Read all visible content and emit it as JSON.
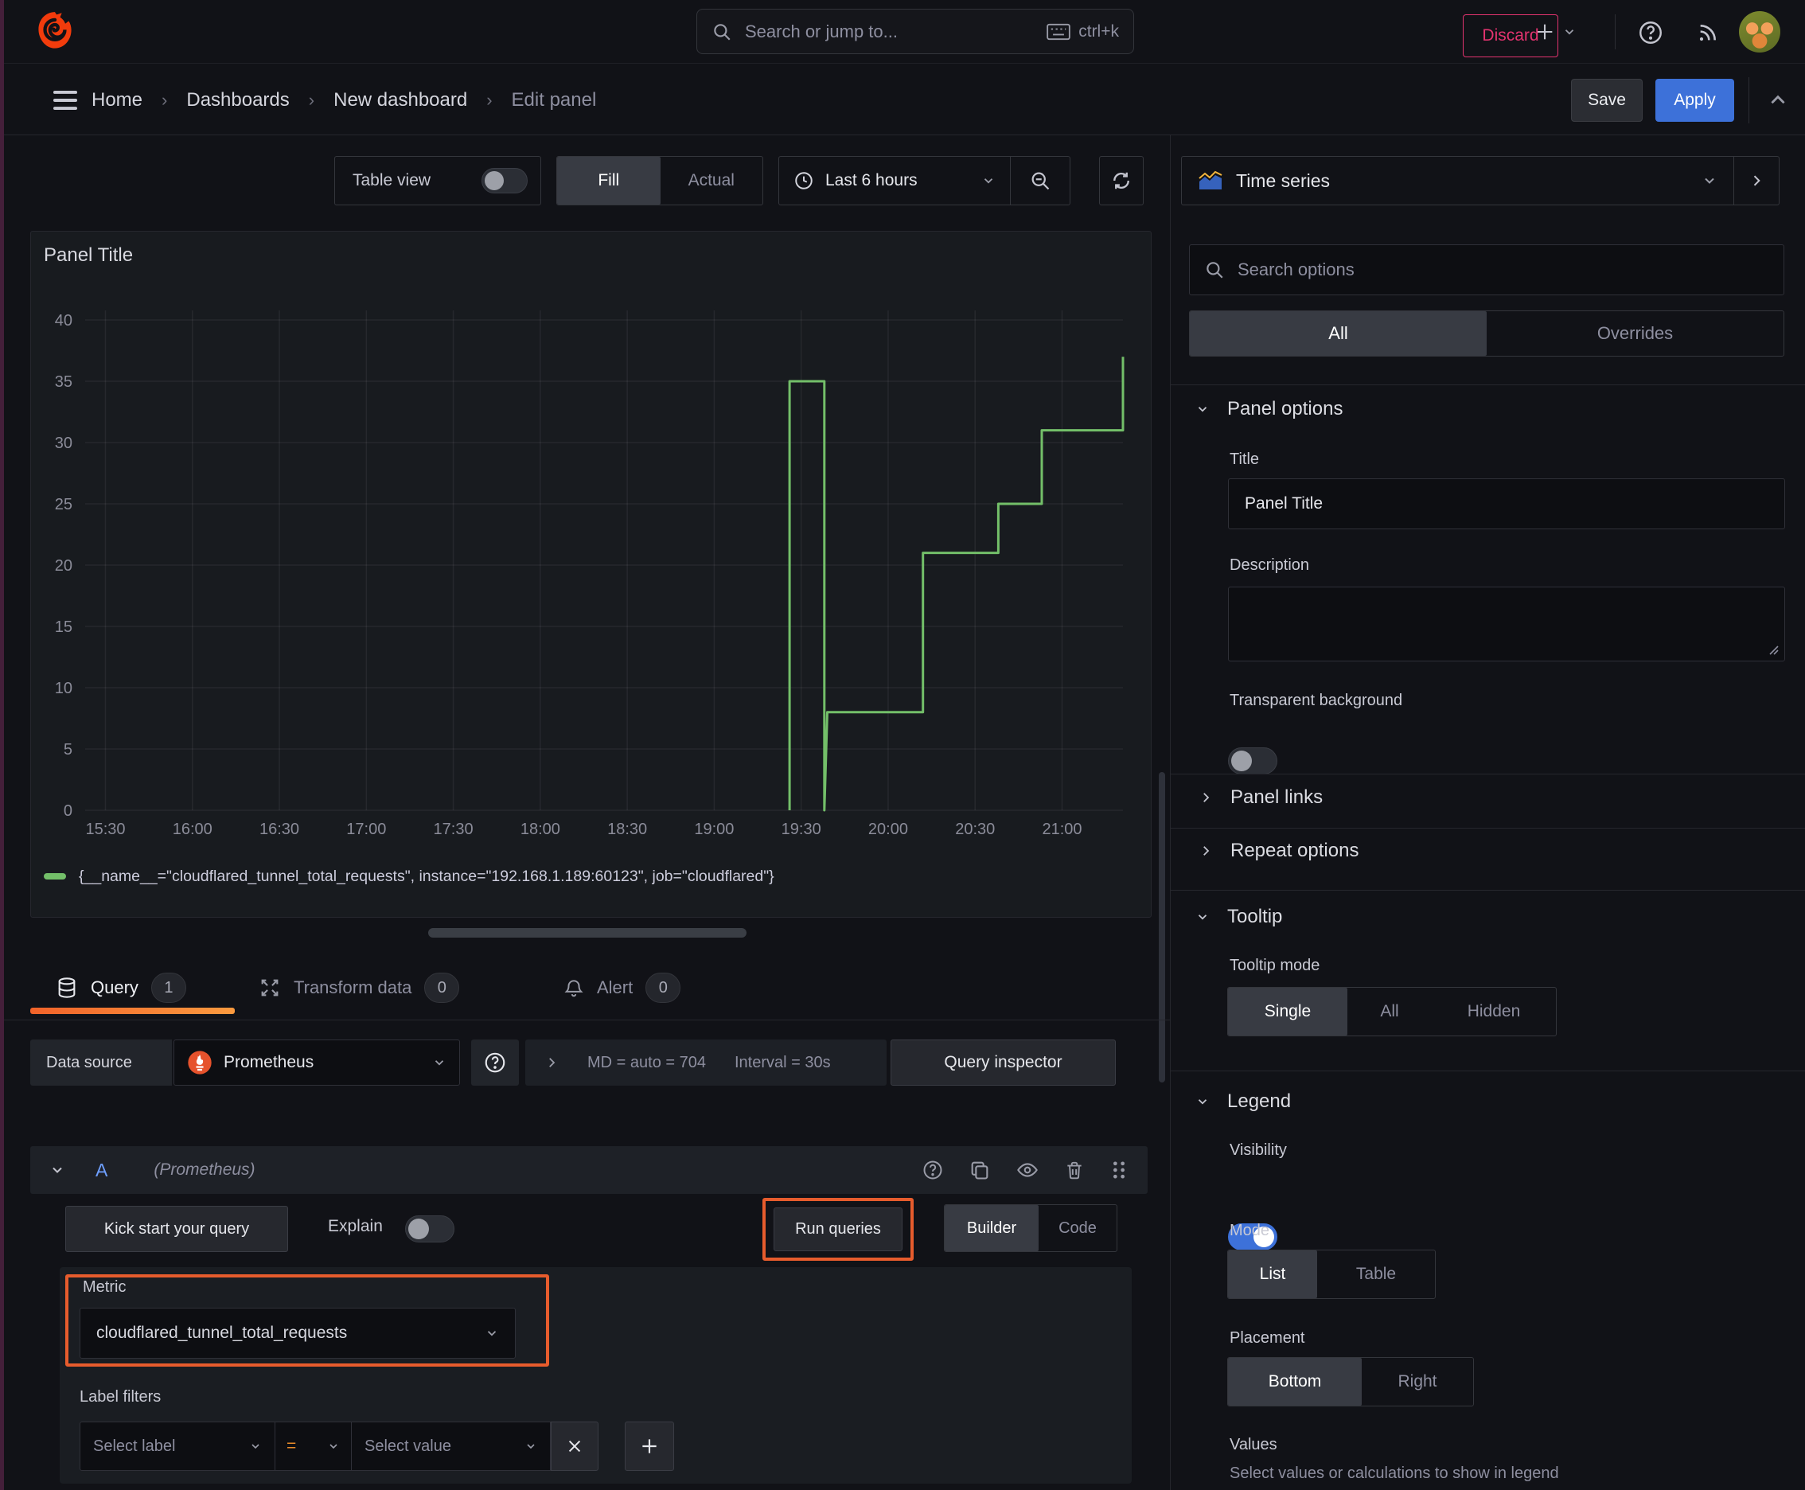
{
  "topbar": {
    "search_placeholder": "Search or jump to...",
    "shortcut": "ctrl+k"
  },
  "breadcrumb": {
    "items": [
      "Home",
      "Dashboards",
      "New dashboard",
      "Edit panel"
    ]
  },
  "actions": {
    "discard": "Discard",
    "save": "Save",
    "apply": "Apply"
  },
  "toolbar": {
    "table_view": "Table view",
    "fill": "Fill",
    "actual": "Actual",
    "time_range": "Last 6 hours"
  },
  "viz_picker": {
    "label": "Time series"
  },
  "panel": {
    "title": "Panel Title"
  },
  "chart_data": {
    "type": "line",
    "line_style": "step",
    "title": "Panel Title",
    "x_domain": [
      "15:23",
      "21:21"
    ],
    "x_ticks": [
      "15:30",
      "16:00",
      "16:30",
      "17:00",
      "17:30",
      "18:00",
      "18:30",
      "19:00",
      "19:30",
      "20:00",
      "20:30",
      "21:00"
    ],
    "ylim": [
      0,
      40
    ],
    "y_ticks": [
      0,
      5,
      10,
      15,
      20,
      25,
      30,
      35,
      40
    ],
    "grid": true,
    "legend_position": "bottom",
    "series": [
      {
        "name": "{__name__=\"cloudflared_tunnel_total_requests\", instance=\"192.168.1.189:60123\", job=\"cloudflared\"}",
        "color": "#73bf69",
        "points": [
          [
            "19:26",
            0
          ],
          [
            "19:26",
            35
          ],
          [
            "19:38",
            35
          ],
          [
            "19:38",
            0
          ],
          [
            "19:39",
            8
          ],
          [
            "20:12",
            8
          ],
          [
            "20:12",
            21
          ],
          [
            "20:38",
            21
          ],
          [
            "20:38",
            25
          ],
          [
            "20:53",
            25
          ],
          [
            "20:53",
            31
          ],
          [
            "21:21",
            31
          ],
          [
            "21:21",
            37
          ]
        ]
      }
    ]
  },
  "tabs": {
    "query": "Query",
    "query_count": "1",
    "transform": "Transform data",
    "transform_count": "0",
    "alert": "Alert",
    "alert_count": "0"
  },
  "datasource": {
    "label": "Data source",
    "name": "Prometheus",
    "stats_md": "MD = auto = 704",
    "stats_interval": "Interval = 30s",
    "query_inspector": "Query inspector"
  },
  "query_editor": {
    "ref_id": "A",
    "ds_hint": "(Prometheus)",
    "kick_start": "Kick start your query",
    "explain": "Explain",
    "run_queries": "Run queries",
    "builder": "Builder",
    "code": "Code",
    "metric_label": "Metric",
    "metric_value": "cloudflared_tunnel_total_requests",
    "label_filters": "Label filters",
    "select_label": "Select label",
    "operator": "=",
    "select_value": "Select value"
  },
  "options_pane": {
    "search_placeholder": "Search options",
    "tab_all": "All",
    "tab_overrides": "Overrides",
    "panel_options": {
      "title": "Panel options",
      "title_label": "Title",
      "title_value": "Panel Title",
      "description_label": "Description",
      "transparent_label": "Transparent background"
    },
    "panel_links": "Panel links",
    "repeat_options": "Repeat options",
    "tooltip": {
      "title": "Tooltip",
      "mode_label": "Tooltip mode",
      "mode_single": "Single",
      "mode_all": "All",
      "mode_hidden": "Hidden"
    },
    "legend": {
      "title": "Legend",
      "visibility_label": "Visibility",
      "mode_label": "Mode",
      "mode_list": "List",
      "mode_table": "Table",
      "placement_label": "Placement",
      "placement_bottom": "Bottom",
      "placement_right": "Right",
      "values_label": "Values",
      "values_hint": "Select values or calculations to show in legend"
    }
  },
  "colors": {
    "series_green": "#73bf69",
    "accent_orange": "#e75c2d",
    "primary_blue": "#3d71d9",
    "destructive_pink": "#e3336f"
  }
}
